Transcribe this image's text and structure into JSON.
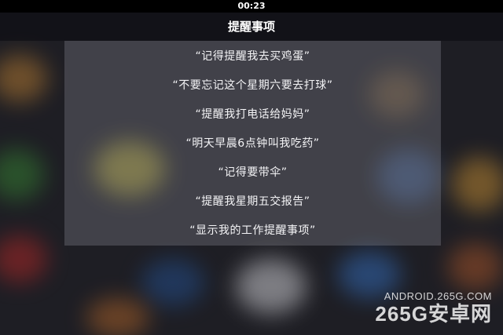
{
  "status_bar": {
    "time": "00:23"
  },
  "header": {
    "title": "提醒事项"
  },
  "suggestions": [
    "“记得提醒我去买鸡蛋”",
    "“不要忘记这个星期六要去打球”",
    "“提醒我打电话给妈妈”",
    "“明天早晨6点钟叫我吃药”",
    "“记得要带伞”",
    "“提醒我星期五交报告”",
    "“显示我的工作提醒事项”"
  ],
  "watermark": {
    "site": "ANDROID.265G.COM",
    "brand": "265G安卓网"
  },
  "colors": {
    "status_bar_bg": "#000000",
    "panel_bg": "rgba(150,150,160,0.30)",
    "text": "#f4f4f6"
  }
}
